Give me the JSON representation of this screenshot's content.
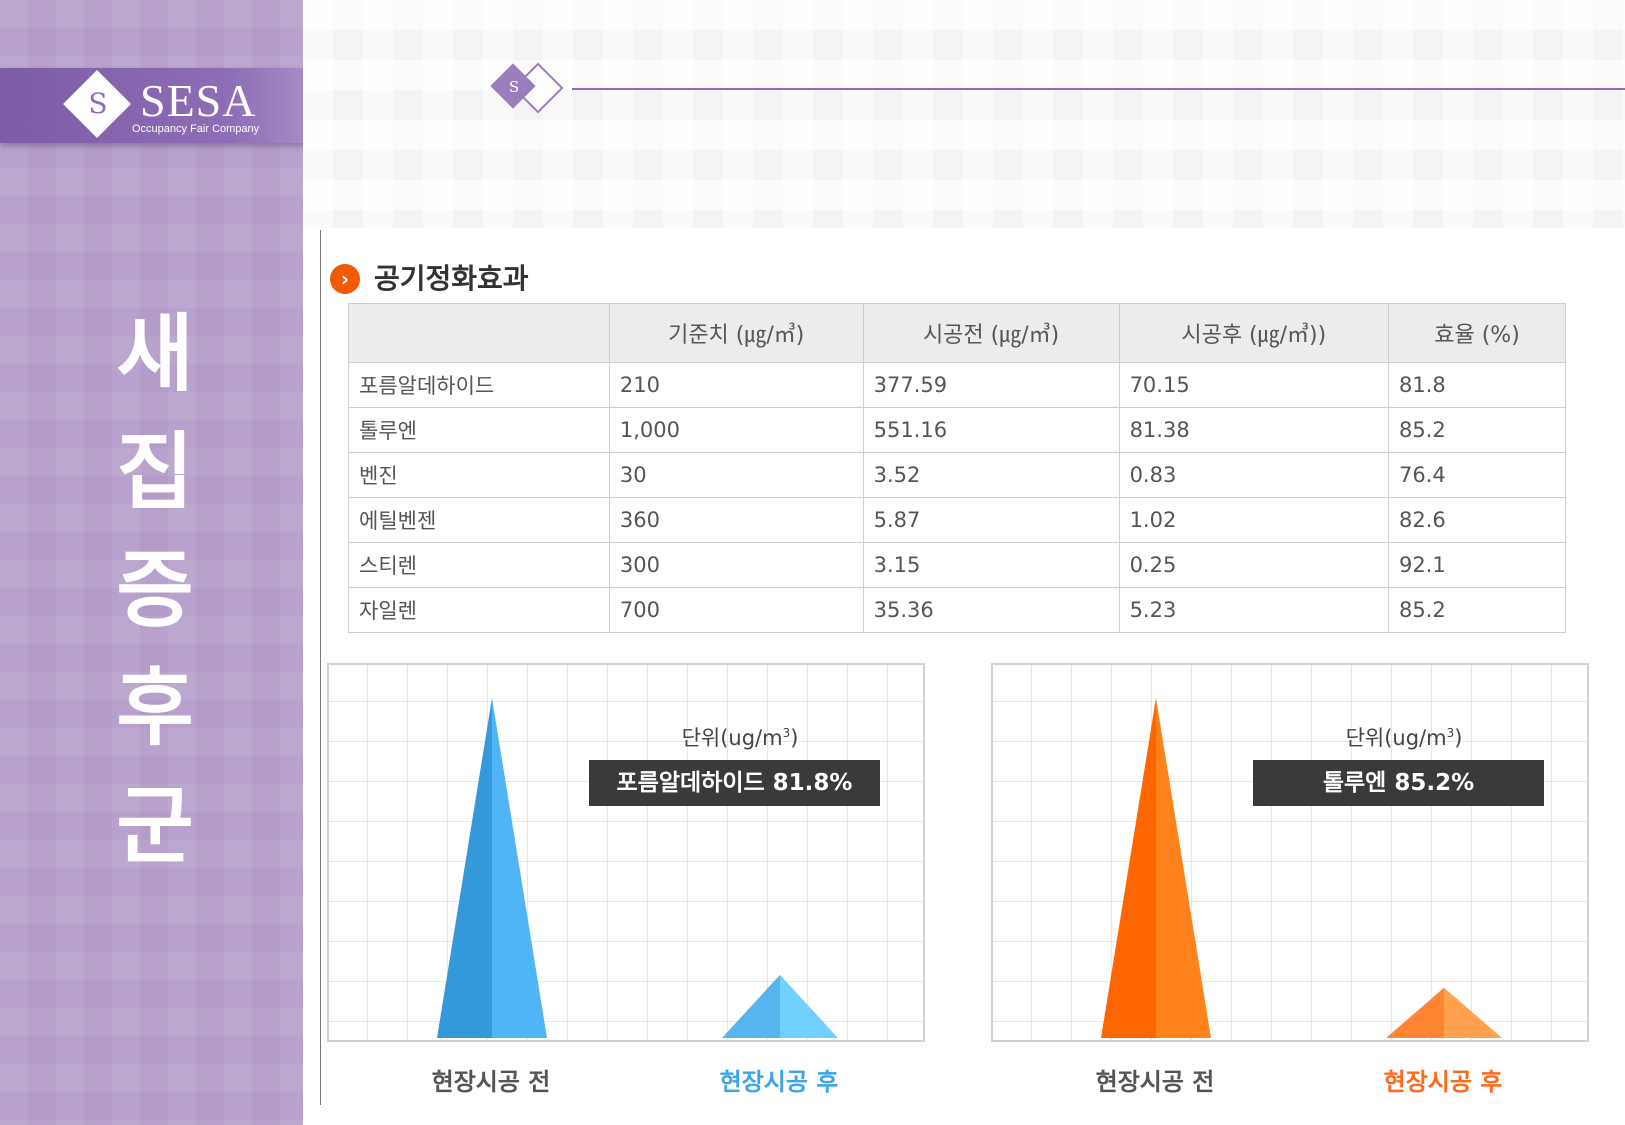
{
  "logo": {
    "name": "SESA",
    "tagline": "Occupancy Fair Company",
    "mark": "S"
  },
  "sidebar": {
    "title_chars": [
      "새",
      "집",
      "증",
      "후",
      "군"
    ]
  },
  "section": {
    "icon": "chevron-right-icon",
    "title": "공기정화효과"
  },
  "table": {
    "headers": [
      "",
      "기준치 (㎍/㎥)",
      "시공전 (㎍/㎥)",
      "시공후 (㎍/㎥))",
      "효율 (%)"
    ],
    "rows": [
      [
        "포름알데하이드",
        "210",
        "377.59",
        "70.15",
        "81.8"
      ],
      [
        "톨루엔",
        "1,000",
        "551.16",
        "81.38",
        "85.2"
      ],
      [
        "벤진",
        "30",
        "3.52",
        "0.83",
        "76.4"
      ],
      [
        "에틸벤젠",
        "360",
        "5.87",
        "1.02",
        "82.6"
      ],
      [
        "스티렌",
        "300",
        "3.15",
        "0.25",
        "92.1"
      ],
      [
        "자일렌",
        "700",
        "35.36",
        "5.23",
        "85.2"
      ]
    ]
  },
  "colors": {
    "sidebar": "#b49cc9",
    "accent": "#8e6db5",
    "blue_dark": "#3399db",
    "blue_light": "#56b4ef",
    "orange_dark": "#ff6600",
    "orange_light": "#ff8533",
    "section_icon": "#f25a06"
  },
  "chart_data": [
    {
      "type": "bar",
      "categories": [
        "현장시공 전",
        "현장시공 후"
      ],
      "values": [
        377.59,
        70.15
      ],
      "unit_prefix": "단위(ug/m",
      "unit_sup": "3",
      "unit_suffix": ")",
      "badge": "포름알데하이드 81.8%",
      "colors": [
        "#3399db",
        "#56b4ef"
      ]
    },
    {
      "type": "bar",
      "categories": [
        "현장시공 전",
        "현장시공 후"
      ],
      "values": [
        551.16,
        81.38
      ],
      "unit_prefix": "단위(ug/m",
      "unit_sup": "3",
      "unit_suffix": ")",
      "badge": "톨루엔 85.2%",
      "colors": [
        "#ff6600",
        "#ff8533"
      ]
    }
  ]
}
